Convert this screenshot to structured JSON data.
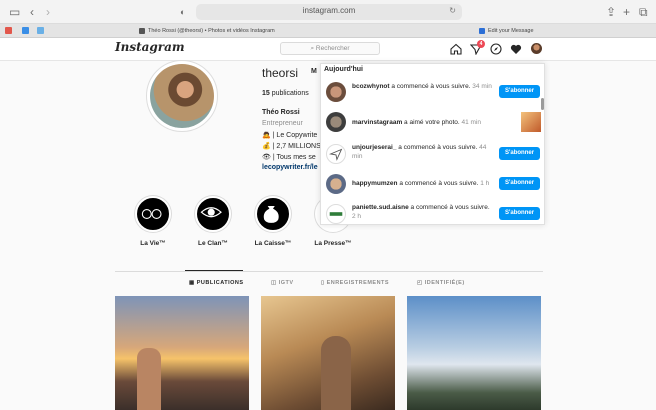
{
  "browser": {
    "url": "instagram.com",
    "tabs": [
      {
        "label": "Théo Rossi (@theorsi) • Photos et vidéos Instagram"
      },
      {
        "label": "Edit your Message"
      }
    ]
  },
  "header": {
    "logo": "Instagram",
    "search_placeholder": "Rechercher",
    "notif_badge": "4"
  },
  "profile": {
    "username": "theorsi",
    "msg_btn_fragment": "M",
    "publications_count": "15",
    "publications_label": " publications",
    "name": "Théo Rossi",
    "category": "Entrepreneur",
    "bio_lines": [
      "🙇 | Le Copywrite",
      "💰 | 2,7 MILLIONS",
      "👁 | Tous mes se"
    ],
    "link": "lecopywriter.fr/le"
  },
  "stories": [
    {
      "label": "La Vie™",
      "icon": "sunglasses-icon"
    },
    {
      "label": "Le Clan™",
      "icon": "eye-icon"
    },
    {
      "label": "La Caisse™",
      "icon": "money-bag-icon"
    },
    {
      "label": "La Presse™",
      "icon": "press-logo-icon"
    }
  ],
  "profile_tabs": [
    {
      "label": "PUBLICATIONS",
      "icon": "grid-icon"
    },
    {
      "label": "IGTV",
      "icon": "tv-icon"
    },
    {
      "label": "ENREGISTREMENTS",
      "icon": "bookmark-icon"
    },
    {
      "label": "IDENTIFIÉ(E)",
      "icon": "tag-icon"
    }
  ],
  "notifications": {
    "section_title": "Aujourd'hui",
    "items": [
      {
        "user": "bcozwhynot",
        "text": " a commencé à vous suivre.",
        "time": " 34 min",
        "action": "S'abonner"
      },
      {
        "user": "marvinstagraam",
        "text": " a aimé votre photo.",
        "time": " 41 min",
        "action": ""
      },
      {
        "user": "unjourjeserai_",
        "text": " a commencé à vous suivre.",
        "time": " 44 min",
        "action": "S'abonner"
      },
      {
        "user": "happymumzen",
        "text": " a commencé à vous suivre.",
        "time": " 1 h",
        "action": "S'abonner"
      },
      {
        "user": "paniette.sud.aisne",
        "text": " a commencé à vous suivre.",
        "time": " 2 h",
        "action": "S'abonner"
      }
    ]
  },
  "colors": {
    "accent": "#0095f6",
    "badge": "#ed4956"
  }
}
